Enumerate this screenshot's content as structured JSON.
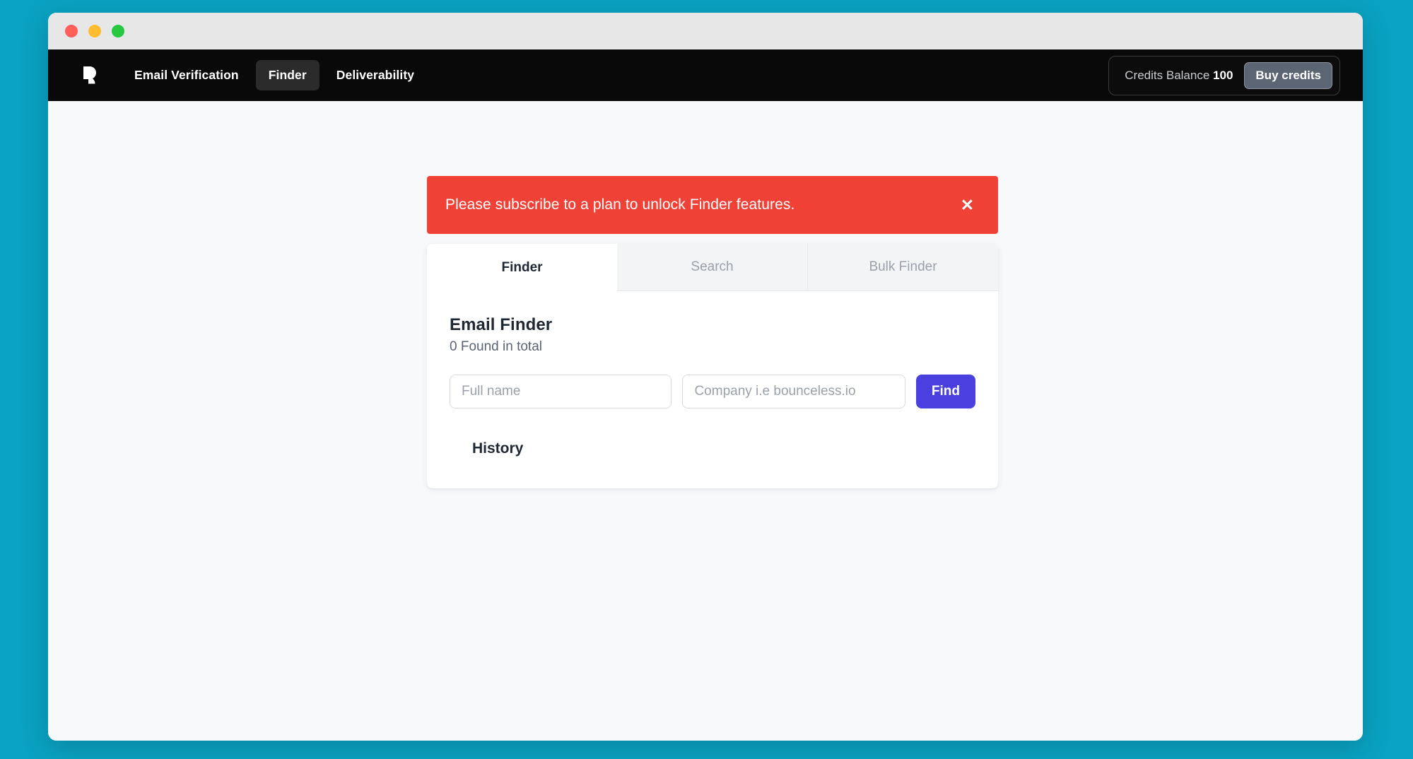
{
  "window": {
    "traffic_lights": [
      {
        "name": "close",
        "color": "#ff5f57"
      },
      {
        "name": "minimize",
        "color": "#febc2e"
      },
      {
        "name": "maximize",
        "color": "#28c840"
      }
    ]
  },
  "theme": {
    "desktop_bg": "#0aa2c2",
    "navbar_bg": "#090909",
    "page_bg": "#f7f9fb",
    "alert_red": "#ef4136",
    "accent_purple": "#4a40e0",
    "buy_credits_bg": "#5b6574"
  },
  "navbar": {
    "logo_name": "bounceless-logo",
    "links": [
      {
        "label": "Email Verification",
        "active": false
      },
      {
        "label": "Finder",
        "active": true
      },
      {
        "label": "Deliverability",
        "active": false
      }
    ],
    "credits": {
      "label": "Credits Balance",
      "value": "100",
      "buy_button": "Buy credits"
    }
  },
  "alert": {
    "message": "Please subscribe to a plan to unlock Finder features.",
    "close_icon": "close-icon"
  },
  "tabs": [
    {
      "label": "Finder",
      "active": true
    },
    {
      "label": "Search",
      "active": false
    },
    {
      "label": "Bulk Finder",
      "active": false
    }
  ],
  "finder": {
    "title": "Email Finder",
    "subtitle": "0 Found in total",
    "fullname_placeholder": "Full name",
    "fullname_value": "",
    "company_placeholder": "Company i.e bounceless.io",
    "company_value": "",
    "find_button": "Find",
    "history_title": "History"
  }
}
